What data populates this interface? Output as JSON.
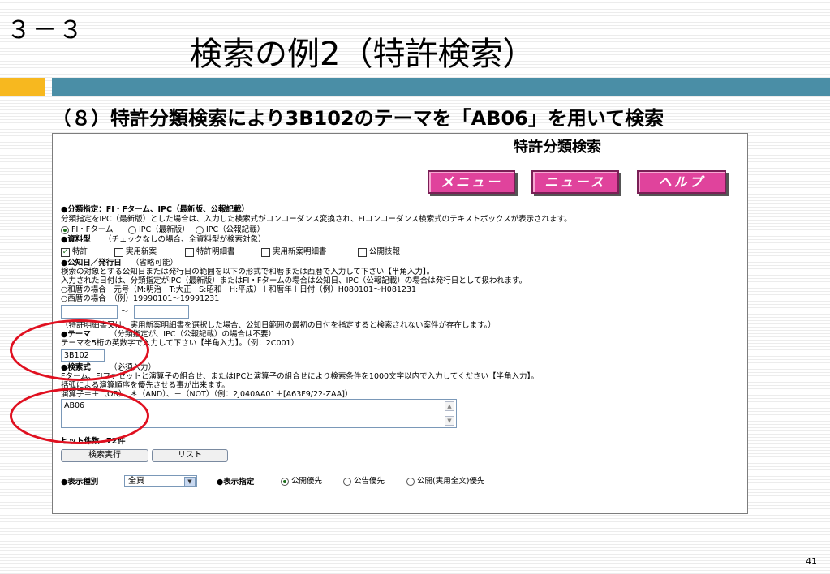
{
  "slide": {
    "section_number": "３－３",
    "title": "検索の例2（特許検索）",
    "subtitle": "（８）特許分類検索により3B102のテーマを「AB06」を用いて検索",
    "page_number": "41",
    "colors": {
      "orange_bar": "#f7b81f",
      "teal_bar": "#4a8ea6",
      "nav_button": "#e0439c",
      "annotation_circle": "#e01020"
    }
  },
  "app": {
    "page_title": "特許分類検索",
    "nav": {
      "menu": "メニュー",
      "news": "ニュース",
      "help": "ヘルプ"
    },
    "classification": {
      "heading": "●分類指定：FI・Fターム、IPC（最新版、公報記載）",
      "description": "分類指定をIPC（最新版）とした場合は、入力した検索式がコンコーダンス変換され、FIコンコーダンス検索式のテキストボックスが表示されます。",
      "options": [
        "FI・Fターム",
        "IPC（最新版）",
        "IPC（公報記載）"
      ],
      "selected": "FI・Fターム"
    },
    "doc_type": {
      "heading": "●資料型",
      "note": "（チェックなしの場合、全資料型が検索対象）",
      "options": [
        "特許",
        "実用新案",
        "特許明細書",
        "実用新案明細書",
        "公開技報"
      ],
      "checked": [
        "特許"
      ]
    },
    "date": {
      "heading": "●公知日／発行日",
      "note": "（省略可能）",
      "line1": "検索の対象とする公知日または発行日の範囲を以下の形式で和暦または西暦で入力して下さい【半角入力】。",
      "line2": "入力された日付は、分類指定がIPC（最新版）またはFI・Fタームの場合は公知日、IPC（公報記載）の場合は発行日として扱われます。",
      "line3": "○和暦の場合　元号（M:明治　T:大正　S:昭和　H:平成）＋和暦年＋日付（例）H080101～H081231",
      "line4": "○西暦の場合　（例）19990101～19991231",
      "from_value": "",
      "tilde": "～",
      "to_value": "",
      "warning": "（特許明細書又は、実用新案明細書を選択した場合、公知日範囲の最初の日付を指定すると検索されない案件が存在します。）"
    },
    "theme": {
      "heading": "●テーマ",
      "note": "（分類指定が、IPC（公報記載）の場合は不要）",
      "instruction": "テーマを5桁の英数字で入力して下さい【半角入力】。（例：2C001）",
      "value": "3B102"
    },
    "query": {
      "heading": "●検索式",
      "note": "（必須入力）",
      "line1": "Fターム、FIファセットと演算子の組合せ、またはIPCと演算子の組合せにより検索条件を1000文字以内で入力してください【半角入力】。",
      "line2": "括弧による演算順序を優先させる事が出来ます。",
      "line3": "演算子＝＋（OR）、＊（AND）、－（NOT）（例：2J040AA01＋[A63F9/22-ZAA]）",
      "value": "AB06"
    },
    "hits": {
      "label": "ヒット件数",
      "count": "72",
      "unit": "件"
    },
    "buttons": {
      "execute": "検索実行",
      "list": "リスト"
    },
    "display_type": {
      "label": "●表示種別",
      "selected": "全頁"
    },
    "display_order": {
      "label": "●表示指定",
      "options": [
        "公開優先",
        "公告優先",
        "公開(実用全文)優先"
      ],
      "selected": "公開優先"
    }
  }
}
